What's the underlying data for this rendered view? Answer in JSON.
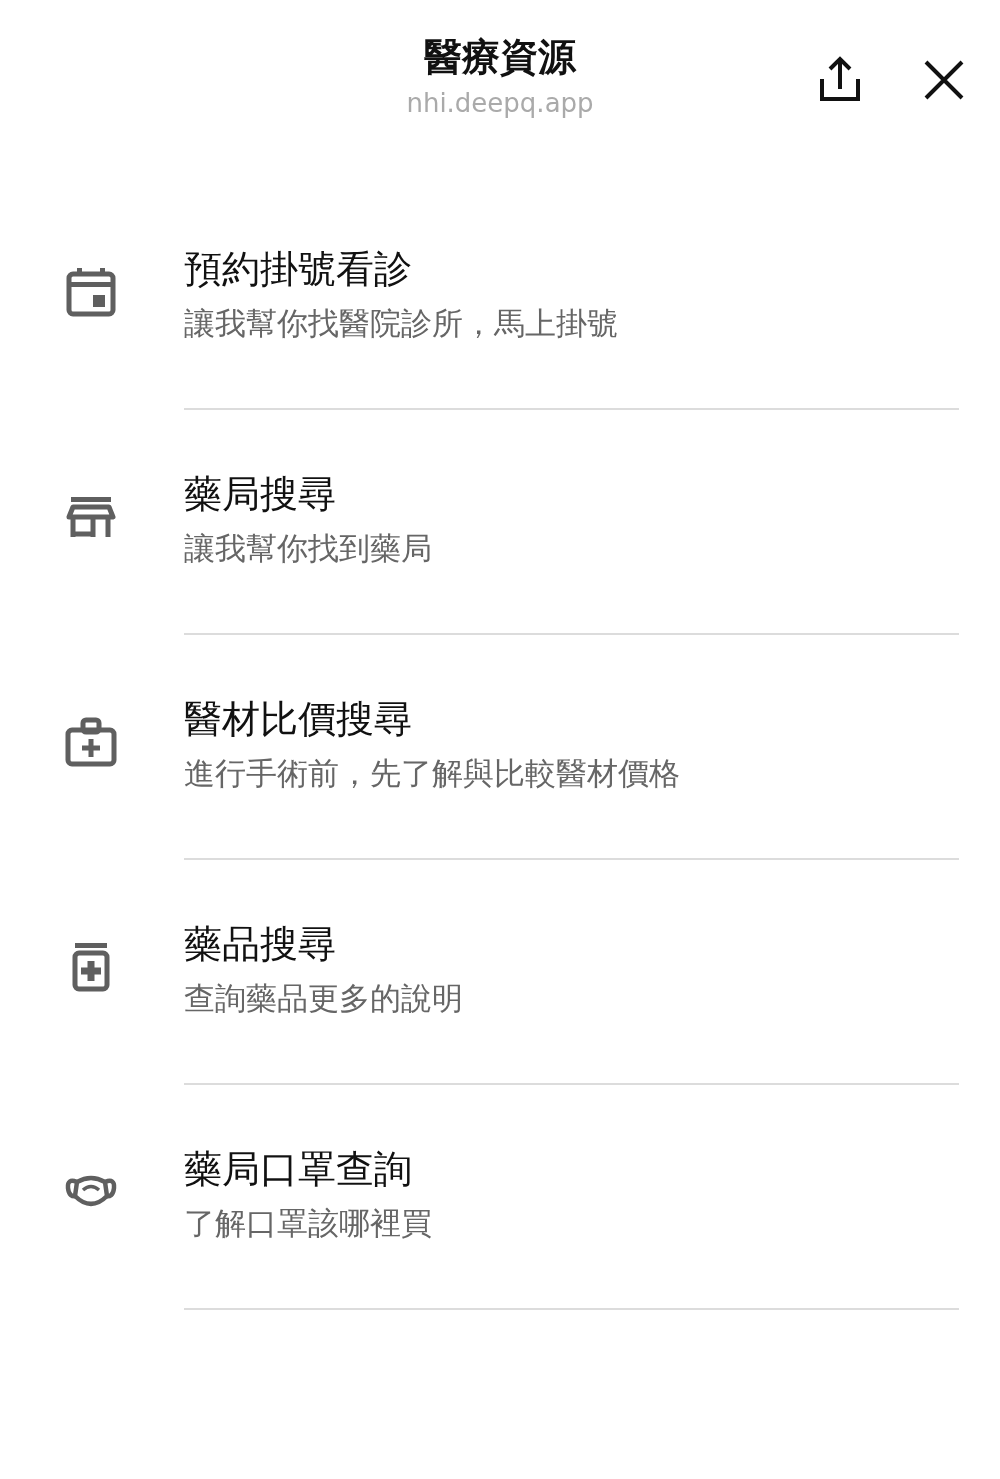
{
  "header": {
    "title": "醫療資源",
    "url": "nhi.deepq.app"
  },
  "items": [
    {
      "kind": "calendar",
      "title": "預約掛號看診",
      "subtitle": "讓我幫你找醫院診所，馬上掛號"
    },
    {
      "kind": "store",
      "title": "藥局搜尋",
      "subtitle": "讓我幫你找到藥局"
    },
    {
      "kind": "medkit",
      "title": "醫材比價搜尋",
      "subtitle": "進行手術前，先了解與比較醫材價格"
    },
    {
      "kind": "medicine",
      "title": "藥品搜尋",
      "subtitle": "查詢藥品更多的說明"
    },
    {
      "kind": "mask",
      "title": "藥局口罩查詢",
      "subtitle": "了解口罩該哪裡買"
    }
  ]
}
